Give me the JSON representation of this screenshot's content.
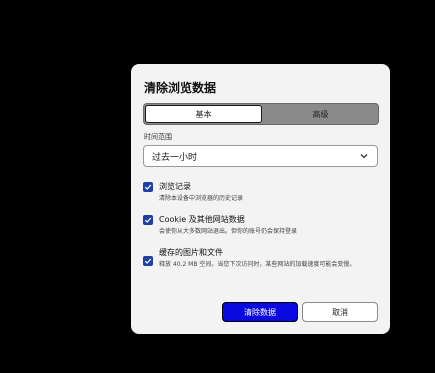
{
  "dialog": {
    "title": "清除浏览数据",
    "tabs": [
      {
        "label": "基本",
        "active": true
      },
      {
        "label": "高级",
        "active": false
      }
    ],
    "time_range_label": "时间范围",
    "time_range_value": "过去一小时",
    "options": [
      {
        "title": "浏览记录",
        "description": "清除本设备中浏览器的历史记录",
        "checked": true
      },
      {
        "title": "Cookie 及其他网站数据",
        "description": "会使你从大多数网站退出。但你的账号仍会保持登录",
        "checked": true
      },
      {
        "title": "缓存的图片和文件",
        "description": "释放 40.2 MB 空间。当您下次访问时，某些网站的加载速度可能会变慢。",
        "checked": true
      }
    ],
    "primary_button": "清除数据",
    "cancel_button": "取消"
  },
  "colors": {
    "accent": "#0a0ae0",
    "checkbox": "#1f3fa8",
    "dialog_bg": "#f3f3f3",
    "backdrop": "#000000"
  },
  "icons": {
    "select_arrow": "chevron-down-icon",
    "checkbox_mark": "checkmark-icon"
  }
}
